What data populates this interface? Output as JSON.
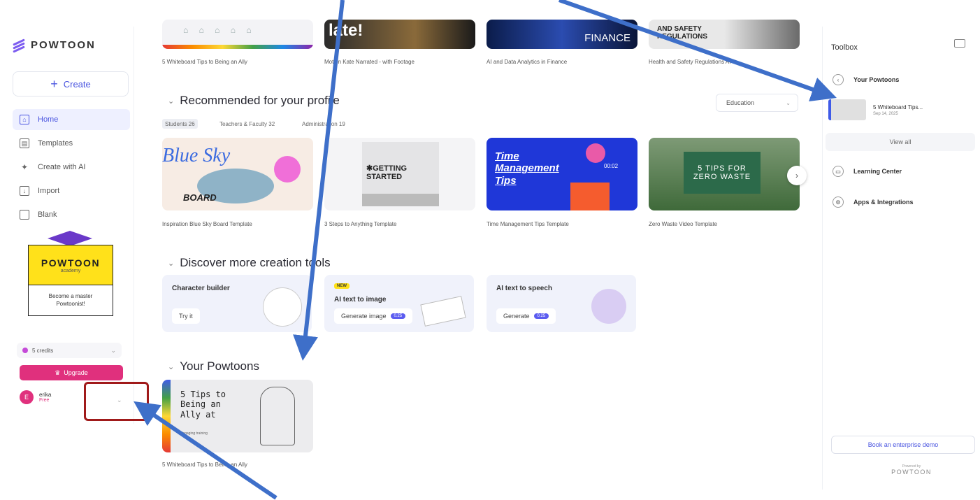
{
  "brand": {
    "name": "POWTOON",
    "academy_sub": "academy"
  },
  "sidebar": {
    "create_label": "Create",
    "items": [
      {
        "label": "Home",
        "icon": "home-icon",
        "active": true
      },
      {
        "label": "Templates",
        "icon": "templates-icon"
      },
      {
        "label": "Create with AI",
        "icon": "sparkle-icon"
      },
      {
        "label": "Import",
        "icon": "import-icon"
      },
      {
        "label": "Blank",
        "icon": "blank-icon"
      }
    ],
    "academy_text": "Become a master Powtoonist!",
    "credits": "5 credits",
    "upgrade": "Upgrade",
    "user_initial": "E",
    "user_name": "erika",
    "user_plan": "Free"
  },
  "top_row": {
    "captions": [
      "5 Whiteboard Tips to Being an Ally",
      "Motion Kate Narrated - with Footage",
      "AI and Data Analytics in Finance",
      "Health and Safety Regulations AI"
    ],
    "thumb_texts": [
      "late!",
      "FINANCE",
      "AND SAFETY REGULATIONS"
    ]
  },
  "recommended": {
    "title": "Recommended for your profile",
    "filter": "Education",
    "chips": [
      "Students 26",
      "Teachers & Faculty 32",
      "Administration 19"
    ],
    "cards": [
      {
        "line1": "Blue Sky",
        "line2": "BOARD",
        "caption": "Inspiration Blue Sky Board Template"
      },
      {
        "line1": "✱GETTING STARTED",
        "caption": "3 Steps to Anything Template"
      },
      {
        "line1": "Time Management Tips",
        "timer": "00:02",
        "caption": "Time Management Tips Template"
      },
      {
        "line1": "5 TIPS FOR ZERO WASTE",
        "caption": "Zero Waste Video Template"
      }
    ]
  },
  "discover": {
    "title": "Discover more creation tools",
    "tools": [
      {
        "title": "Character builder",
        "button": "Try it"
      },
      {
        "badge": "NEW",
        "title": "AI text to image",
        "button": "Generate image",
        "pill": "0.25"
      },
      {
        "title": "AI text to speech",
        "button": "Generate",
        "pill": "0.25"
      }
    ]
  },
  "your_powtoons": {
    "title": "Your Powtoons",
    "card_text": "5 Tips to Being an Ally at",
    "card_sub": "Engaging training",
    "caption": "5 Whiteboard Tips to Being an Ally"
  },
  "toolbox": {
    "title": "Toolbox",
    "your_powtoons": "Your Powtoons",
    "recent_title": "5 Whiteboard Tips...",
    "recent_date": "Sep 14, 2025",
    "view_all": "View all",
    "learning": "Learning Center",
    "apps": "Apps & Integrations",
    "demo": "Book an enterprise demo",
    "powered_by": "Powered by",
    "powered_brand": "POWTOON"
  },
  "colors": {
    "accent": "#4a55e0",
    "pink": "#e0307d",
    "arrow": "#3e6fc9",
    "highlight": "#a01a1a"
  }
}
